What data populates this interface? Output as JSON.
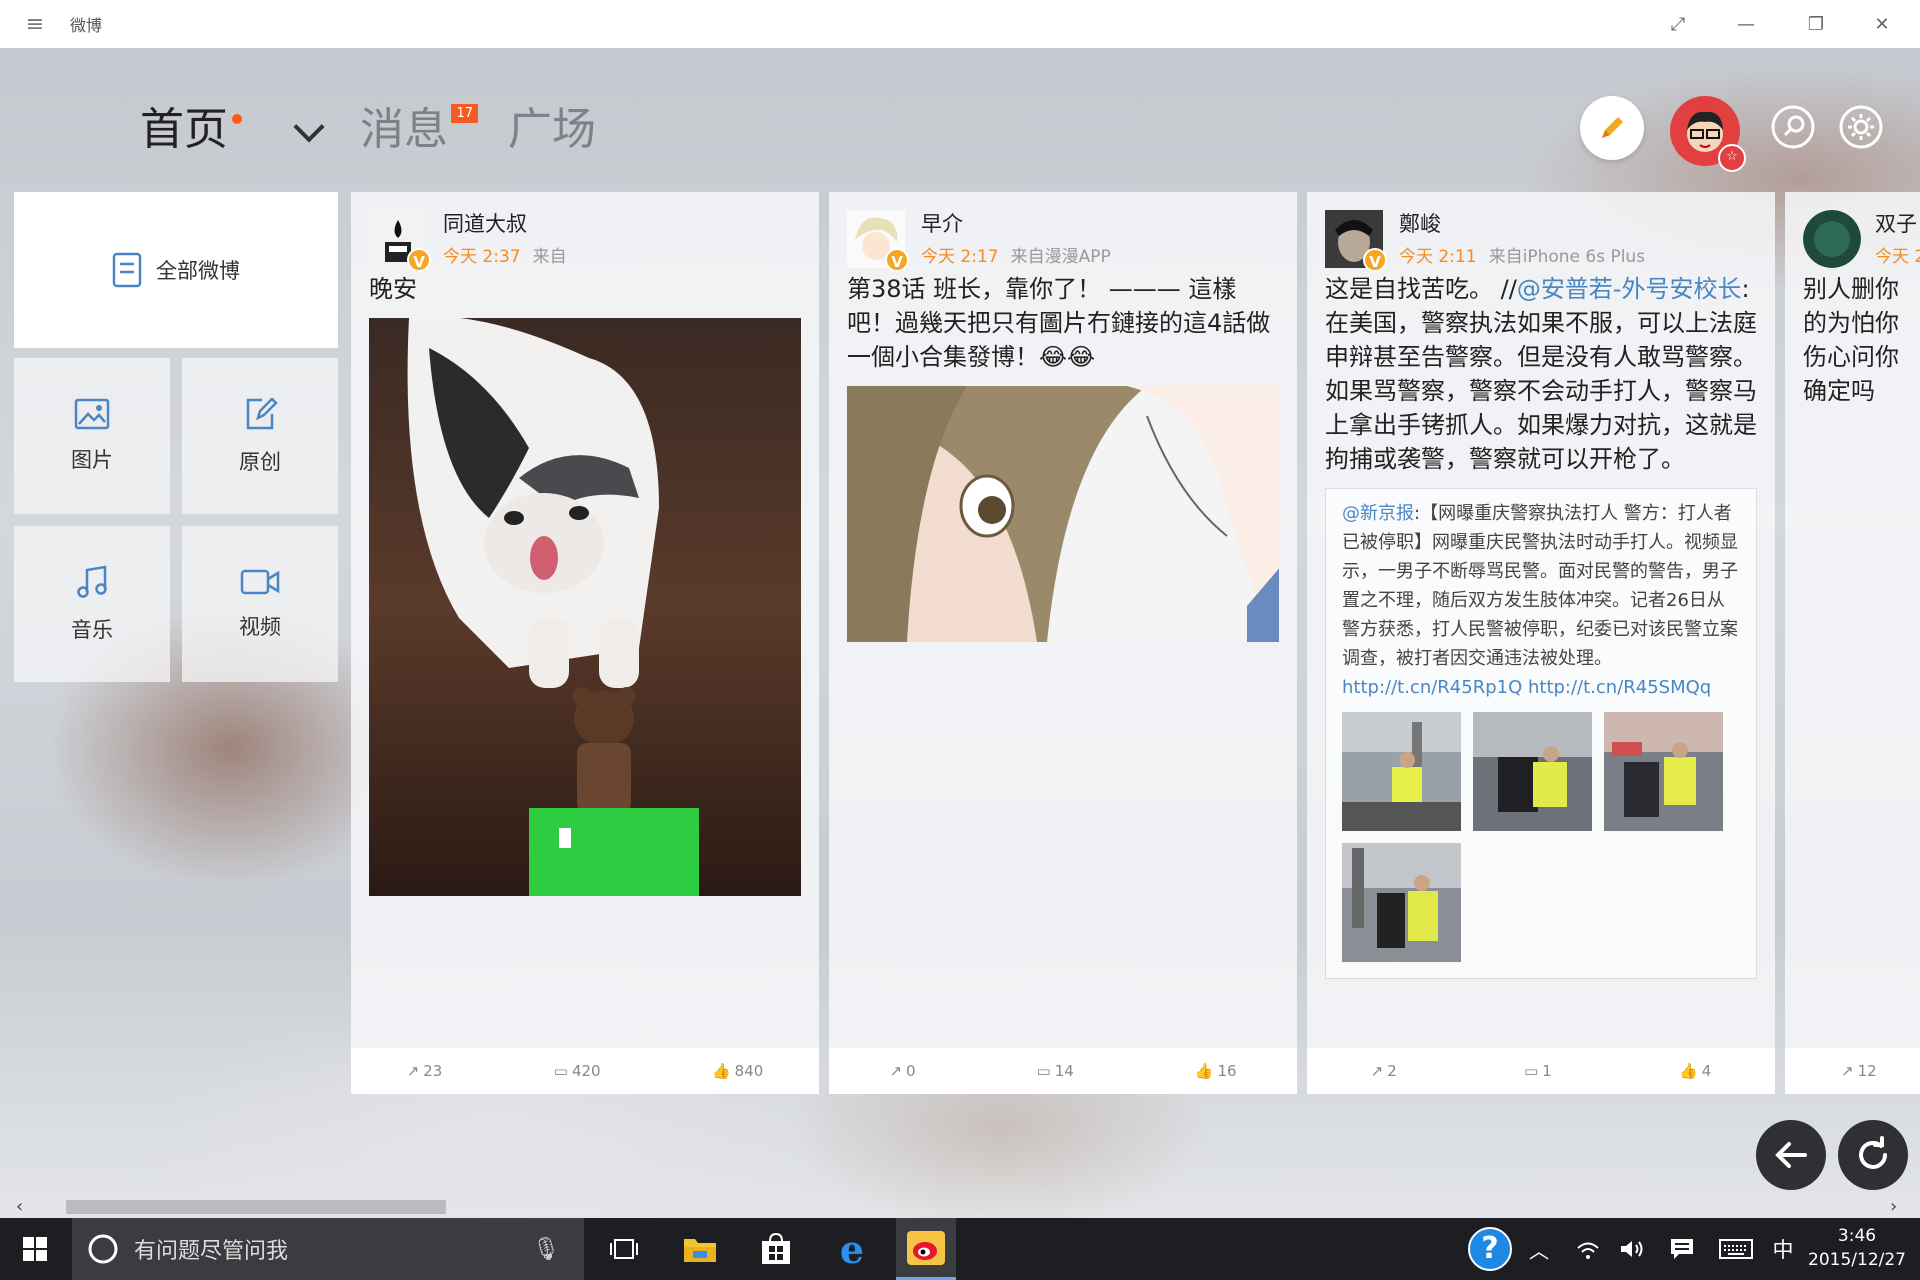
{
  "window": {
    "title": "微博"
  },
  "nav": {
    "tabs": [
      {
        "label": "首页",
        "active": true
      },
      {
        "label": "消息",
        "badge": "17"
      },
      {
        "label": "广场"
      }
    ]
  },
  "left_panel": {
    "all_label": "全部微博",
    "cells": [
      "图片",
      "原创",
      "音乐",
      "视频"
    ]
  },
  "cards": [
    {
      "user": "同道大叔",
      "time": "今天 2:37",
      "source": "来自",
      "text": "晚安",
      "actions": {
        "repost": "23",
        "comment": "420",
        "like": "840"
      }
    },
    {
      "user": "早介",
      "time": "今天 2:17",
      "source": "来自漫漫APP",
      "text": "第38话 班长，靠你了！ ——— 這樣吧！過幾天把只有圖片冇鏈接的這4話做一個小合集發博！😂😂",
      "actions": {
        "repost": "0",
        "comment": "14",
        "like": "16"
      }
    },
    {
      "user": "鄭峻",
      "time": "今天 2:11",
      "source": "来自iPhone 6s Plus",
      "text_pre": "这是自找苦吃。 //",
      "text_link": "@安普若-外号安校长",
      "text_post": ":在美国，警察执法如果不服，可以上法庭申辩甚至告警察。但是没有人敢骂警察。如果骂警察，警察不会动手打人，警察马上拿出手铐抓人。如果爆力对抗，这就是拘捕或袭警，警察就可以开枪了。",
      "repost": {
        "author": "@新京报",
        "body": ":【网曝重庆警察执法打人 警方：打人者已被停职】网曝重庆民警执法时动手打人。视频显示，一男子不断辱骂民警。面对民警的警告，男子置之不理，随后双方发生肢体冲突。记者26日从警方获悉，打人民警被停职，纪委已对该民警立案调查，被打者因交通违法被处理。",
        "links": "http://t.cn/R45Rp1Q http://t.cn/R45SMQq"
      },
      "actions": {
        "repost": "2",
        "comment": "1",
        "like": "4"
      }
    },
    {
      "user": "双子",
      "time": "今天 2",
      "text": "别人删你的为怕你伤心问你确定吗",
      "actions": {
        "repost": "12"
      }
    }
  ],
  "taskbar": {
    "search_placeholder": "有问题尽管问我",
    "ime": "中",
    "time": "3:46",
    "date": "2015/12/27"
  },
  "colors": {
    "accent_orange": "#f58b1f",
    "link_blue": "#4a86c6",
    "badge_red": "#f55a23"
  }
}
